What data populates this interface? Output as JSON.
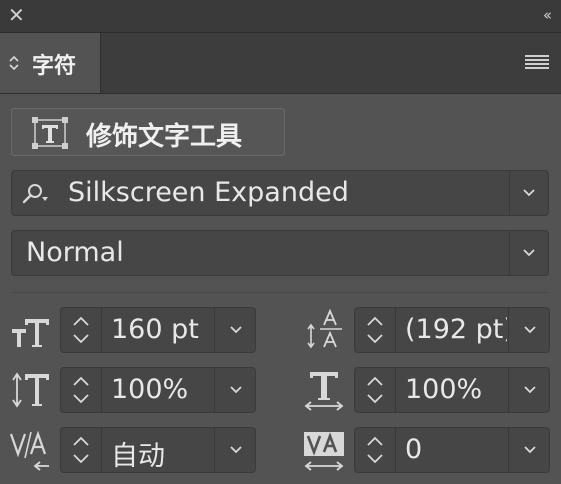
{
  "panel": {
    "close_glyph": "✕",
    "collapse_glyph": "‹‹",
    "tab_label": "字符"
  },
  "touch_type_tool": {
    "label": "修饰文字工具"
  },
  "font_family": {
    "value": "Silkscreen Expanded"
  },
  "font_style": {
    "value": "Normal"
  },
  "properties": {
    "font_size": "160 pt",
    "leading": "(192 pt)",
    "vertical_scale": "100%",
    "horizontal_scale": "100%",
    "kerning": "自动",
    "tracking": "0"
  },
  "icons": {
    "touch_type_tool": "touch-type-tool-icon",
    "font_search": "search-icon",
    "font_size": "font-size-icon",
    "leading": "leading-icon",
    "vertical_scale": "vertical-scale-icon",
    "horizontal_scale": "horizontal-scale-icon",
    "kerning": "kerning-icon",
    "tracking": "tracking-icon"
  },
  "colors": {
    "panel_bg": "#535353",
    "field_bg": "#464646",
    "header_bg": "#3a3a3a",
    "text": "#e8e8e8"
  }
}
